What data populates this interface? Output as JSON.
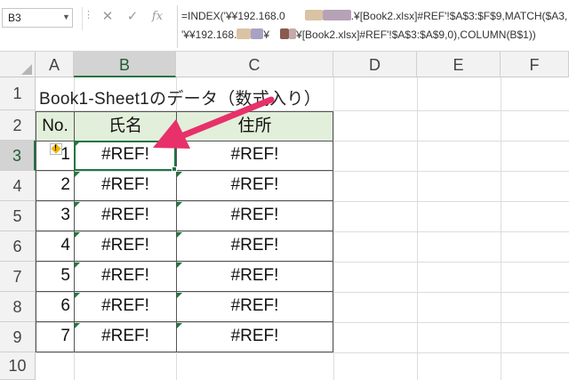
{
  "name_box": "B3",
  "formula_buttons": {
    "cancel": "✕",
    "enter": "✓",
    "function": "fx"
  },
  "formula": {
    "line1_a": "=INDEX('¥¥192.168.0",
    "line1_b": ".¥[Book2.xlsx]#REF'!$A$3:$F$9,MATCH($A3,",
    "line2_a": "'¥¥192.168.",
    "line2_b": "¥",
    "line2_c": "¥[Book2.xlsx]#REF'!$A$3:$A$9,0),COLUMN(B$1))"
  },
  "columns": [
    "A",
    "B",
    "C",
    "D",
    "E",
    "F"
  ],
  "rows": [
    "1",
    "2",
    "3",
    "4",
    "5",
    "6",
    "7",
    "8",
    "9",
    "10"
  ],
  "sheet": {
    "title": "Book1-Sheet1のデータ（数式入り）",
    "headers": {
      "no": "No.",
      "name": "氏名",
      "address": "住所"
    },
    "data": [
      {
        "no": "1",
        "name": "#REF!",
        "address": "#REF!"
      },
      {
        "no": "2",
        "name": "#REF!",
        "address": "#REF!"
      },
      {
        "no": "3",
        "name": "#REF!",
        "address": "#REF!"
      },
      {
        "no": "4",
        "name": "#REF!",
        "address": "#REF!"
      },
      {
        "no": "5",
        "name": "#REF!",
        "address": "#REF!"
      },
      {
        "no": "6",
        "name": "#REF!",
        "address": "#REF!"
      },
      {
        "no": "7",
        "name": "#REF!",
        "address": "#REF!"
      }
    ]
  },
  "active_cell": {
    "column": "B",
    "row": "3"
  },
  "colors": {
    "accent_green": "#217346",
    "header_fill": "#e2efda",
    "arrow": "#e8306a",
    "error_triangle": "#1e7a3a"
  }
}
